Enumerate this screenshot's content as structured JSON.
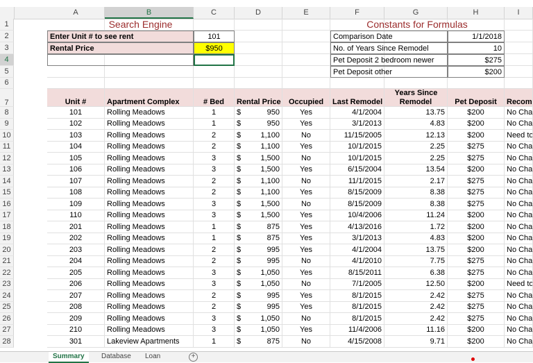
{
  "columns": [
    "A",
    "B",
    "C",
    "D",
    "E",
    "F",
    "G",
    "H",
    "I"
  ],
  "selected_column": "B",
  "selected_row": "4",
  "row_numbers": [
    "1",
    "2",
    "3",
    "4",
    "5",
    "6",
    "7",
    "8",
    "9",
    "10",
    "11",
    "12",
    "13",
    "14",
    "15",
    "16",
    "17",
    "18",
    "19",
    "20",
    "21",
    "22",
    "23",
    "24",
    "25",
    "26",
    "27",
    "28"
  ],
  "search_engine": {
    "title": "Search Engine",
    "unit_label": "Enter Unit # to see rent",
    "unit_value": "101",
    "price_label": "Rental Price",
    "price_value": "$950"
  },
  "constants": {
    "title": "Constants for Formulas",
    "items": [
      {
        "label": "Comparison Date",
        "value": "1/1/2018"
      },
      {
        "label": "No. of Years Since Remodel",
        "value": "10"
      },
      {
        "label": "Pet Deposit 2 bedroom newer",
        "value": "$275"
      },
      {
        "label": "Pet Deposit other",
        "value": "$200"
      }
    ]
  },
  "table": {
    "header_row1": {
      "years_since": "Years Since"
    },
    "headers": [
      "Unit #",
      "Apartment Complex",
      "# Bed",
      "Rental Price",
      "Occupied",
      "Last Remodel",
      "Remodel",
      "Pet Deposit",
      "Recomm"
    ],
    "currency_symbol": "$",
    "rows": [
      {
        "unit": "101",
        "complex": "Rolling Meadows",
        "bed": "1",
        "price": "950",
        "occupied": "Yes",
        "remodel": "4/1/2004",
        "years": "13.75",
        "deposit": "$200",
        "rec": "No Cha"
      },
      {
        "unit": "102",
        "complex": "Rolling Meadows",
        "bed": "1",
        "price": "950",
        "occupied": "Yes",
        "remodel": "3/1/2013",
        "years": "4.83",
        "deposit": "$200",
        "rec": "No Cha"
      },
      {
        "unit": "103",
        "complex": "Rolling Meadows",
        "bed": "2",
        "price": "1,100",
        "occupied": "No",
        "remodel": "11/15/2005",
        "years": "12.13",
        "deposit": "$200",
        "rec": "Need to"
      },
      {
        "unit": "104",
        "complex": "Rolling Meadows",
        "bed": "2",
        "price": "1,100",
        "occupied": "Yes",
        "remodel": "10/1/2015",
        "years": "2.25",
        "deposit": "$275",
        "rec": "No Cha"
      },
      {
        "unit": "105",
        "complex": "Rolling Meadows",
        "bed": "3",
        "price": "1,500",
        "occupied": "No",
        "remodel": "10/1/2015",
        "years": "2.25",
        "deposit": "$275",
        "rec": "No Cha"
      },
      {
        "unit": "106",
        "complex": "Rolling Meadows",
        "bed": "3",
        "price": "1,500",
        "occupied": "Yes",
        "remodel": "6/15/2004",
        "years": "13.54",
        "deposit": "$200",
        "rec": "No Cha"
      },
      {
        "unit": "107",
        "complex": "Rolling Meadows",
        "bed": "2",
        "price": "1,100",
        "occupied": "No",
        "remodel": "11/1/2015",
        "years": "2.17",
        "deposit": "$275",
        "rec": "No Cha"
      },
      {
        "unit": "108",
        "complex": "Rolling Meadows",
        "bed": "2",
        "price": "1,100",
        "occupied": "Yes",
        "remodel": "8/15/2009",
        "years": "8.38",
        "deposit": "$275",
        "rec": "No Cha"
      },
      {
        "unit": "109",
        "complex": "Rolling Meadows",
        "bed": "3",
        "price": "1,500",
        "occupied": "No",
        "remodel": "8/15/2009",
        "years": "8.38",
        "deposit": "$275",
        "rec": "No Cha"
      },
      {
        "unit": "110",
        "complex": "Rolling Meadows",
        "bed": "3",
        "price": "1,500",
        "occupied": "Yes",
        "remodel": "10/4/2006",
        "years": "11.24",
        "deposit": "$200",
        "rec": "No Cha"
      },
      {
        "unit": "201",
        "complex": "Rolling Meadows",
        "bed": "1",
        "price": "875",
        "occupied": "Yes",
        "remodel": "4/13/2016",
        "years": "1.72",
        "deposit": "$200",
        "rec": "No Cha"
      },
      {
        "unit": "202",
        "complex": "Rolling Meadows",
        "bed": "1",
        "price": "875",
        "occupied": "Yes",
        "remodel": "3/1/2013",
        "years": "4.83",
        "deposit": "$200",
        "rec": "No Cha"
      },
      {
        "unit": "203",
        "complex": "Rolling Meadows",
        "bed": "2",
        "price": "995",
        "occupied": "Yes",
        "remodel": "4/1/2004",
        "years": "13.75",
        "deposit": "$200",
        "rec": "No Cha"
      },
      {
        "unit": "204",
        "complex": "Rolling Meadows",
        "bed": "2",
        "price": "995",
        "occupied": "No",
        "remodel": "4/1/2010",
        "years": "7.75",
        "deposit": "$275",
        "rec": "No Cha"
      },
      {
        "unit": "205",
        "complex": "Rolling Meadows",
        "bed": "3",
        "price": "1,050",
        "occupied": "Yes",
        "remodel": "8/15/2011",
        "years": "6.38",
        "deposit": "$275",
        "rec": "No Cha"
      },
      {
        "unit": "206",
        "complex": "Rolling Meadows",
        "bed": "3",
        "price": "1,050",
        "occupied": "No",
        "remodel": "7/1/2005",
        "years": "12.50",
        "deposit": "$200",
        "rec": "Need to"
      },
      {
        "unit": "207",
        "complex": "Rolling Meadows",
        "bed": "2",
        "price": "995",
        "occupied": "Yes",
        "remodel": "8/1/2015",
        "years": "2.42",
        "deposit": "$275",
        "rec": "No Cha"
      },
      {
        "unit": "208",
        "complex": "Rolling Meadows",
        "bed": "2",
        "price": "995",
        "occupied": "Yes",
        "remodel": "8/1/2015",
        "years": "2.42",
        "deposit": "$275",
        "rec": "No Cha"
      },
      {
        "unit": "209",
        "complex": "Rolling Meadows",
        "bed": "3",
        "price": "1,050",
        "occupied": "No",
        "remodel": "8/1/2015",
        "years": "2.42",
        "deposit": "$275",
        "rec": "No Cha"
      },
      {
        "unit": "210",
        "complex": "Rolling Meadows",
        "bed": "3",
        "price": "1,050",
        "occupied": "Yes",
        "remodel": "11/4/2006",
        "years": "11.16",
        "deposit": "$200",
        "rec": "No Cha"
      },
      {
        "unit": "301",
        "complex": "Lakeview Apartments",
        "bed": "1",
        "price": "875",
        "occupied": "No",
        "remodel": "4/15/2008",
        "years": "9.71",
        "deposit": "$200",
        "rec": "No Cha"
      }
    ]
  },
  "sheet_tabs": {
    "items": [
      "Summary",
      "Database",
      "Loan"
    ],
    "active": "Summary",
    "add_icon": "plus-circle-icon"
  },
  "colors": {
    "header_band": "#f2dcdb",
    "title_red": "#9b2c2c",
    "highlight": "#ffff00",
    "excel_green": "#217346"
  }
}
